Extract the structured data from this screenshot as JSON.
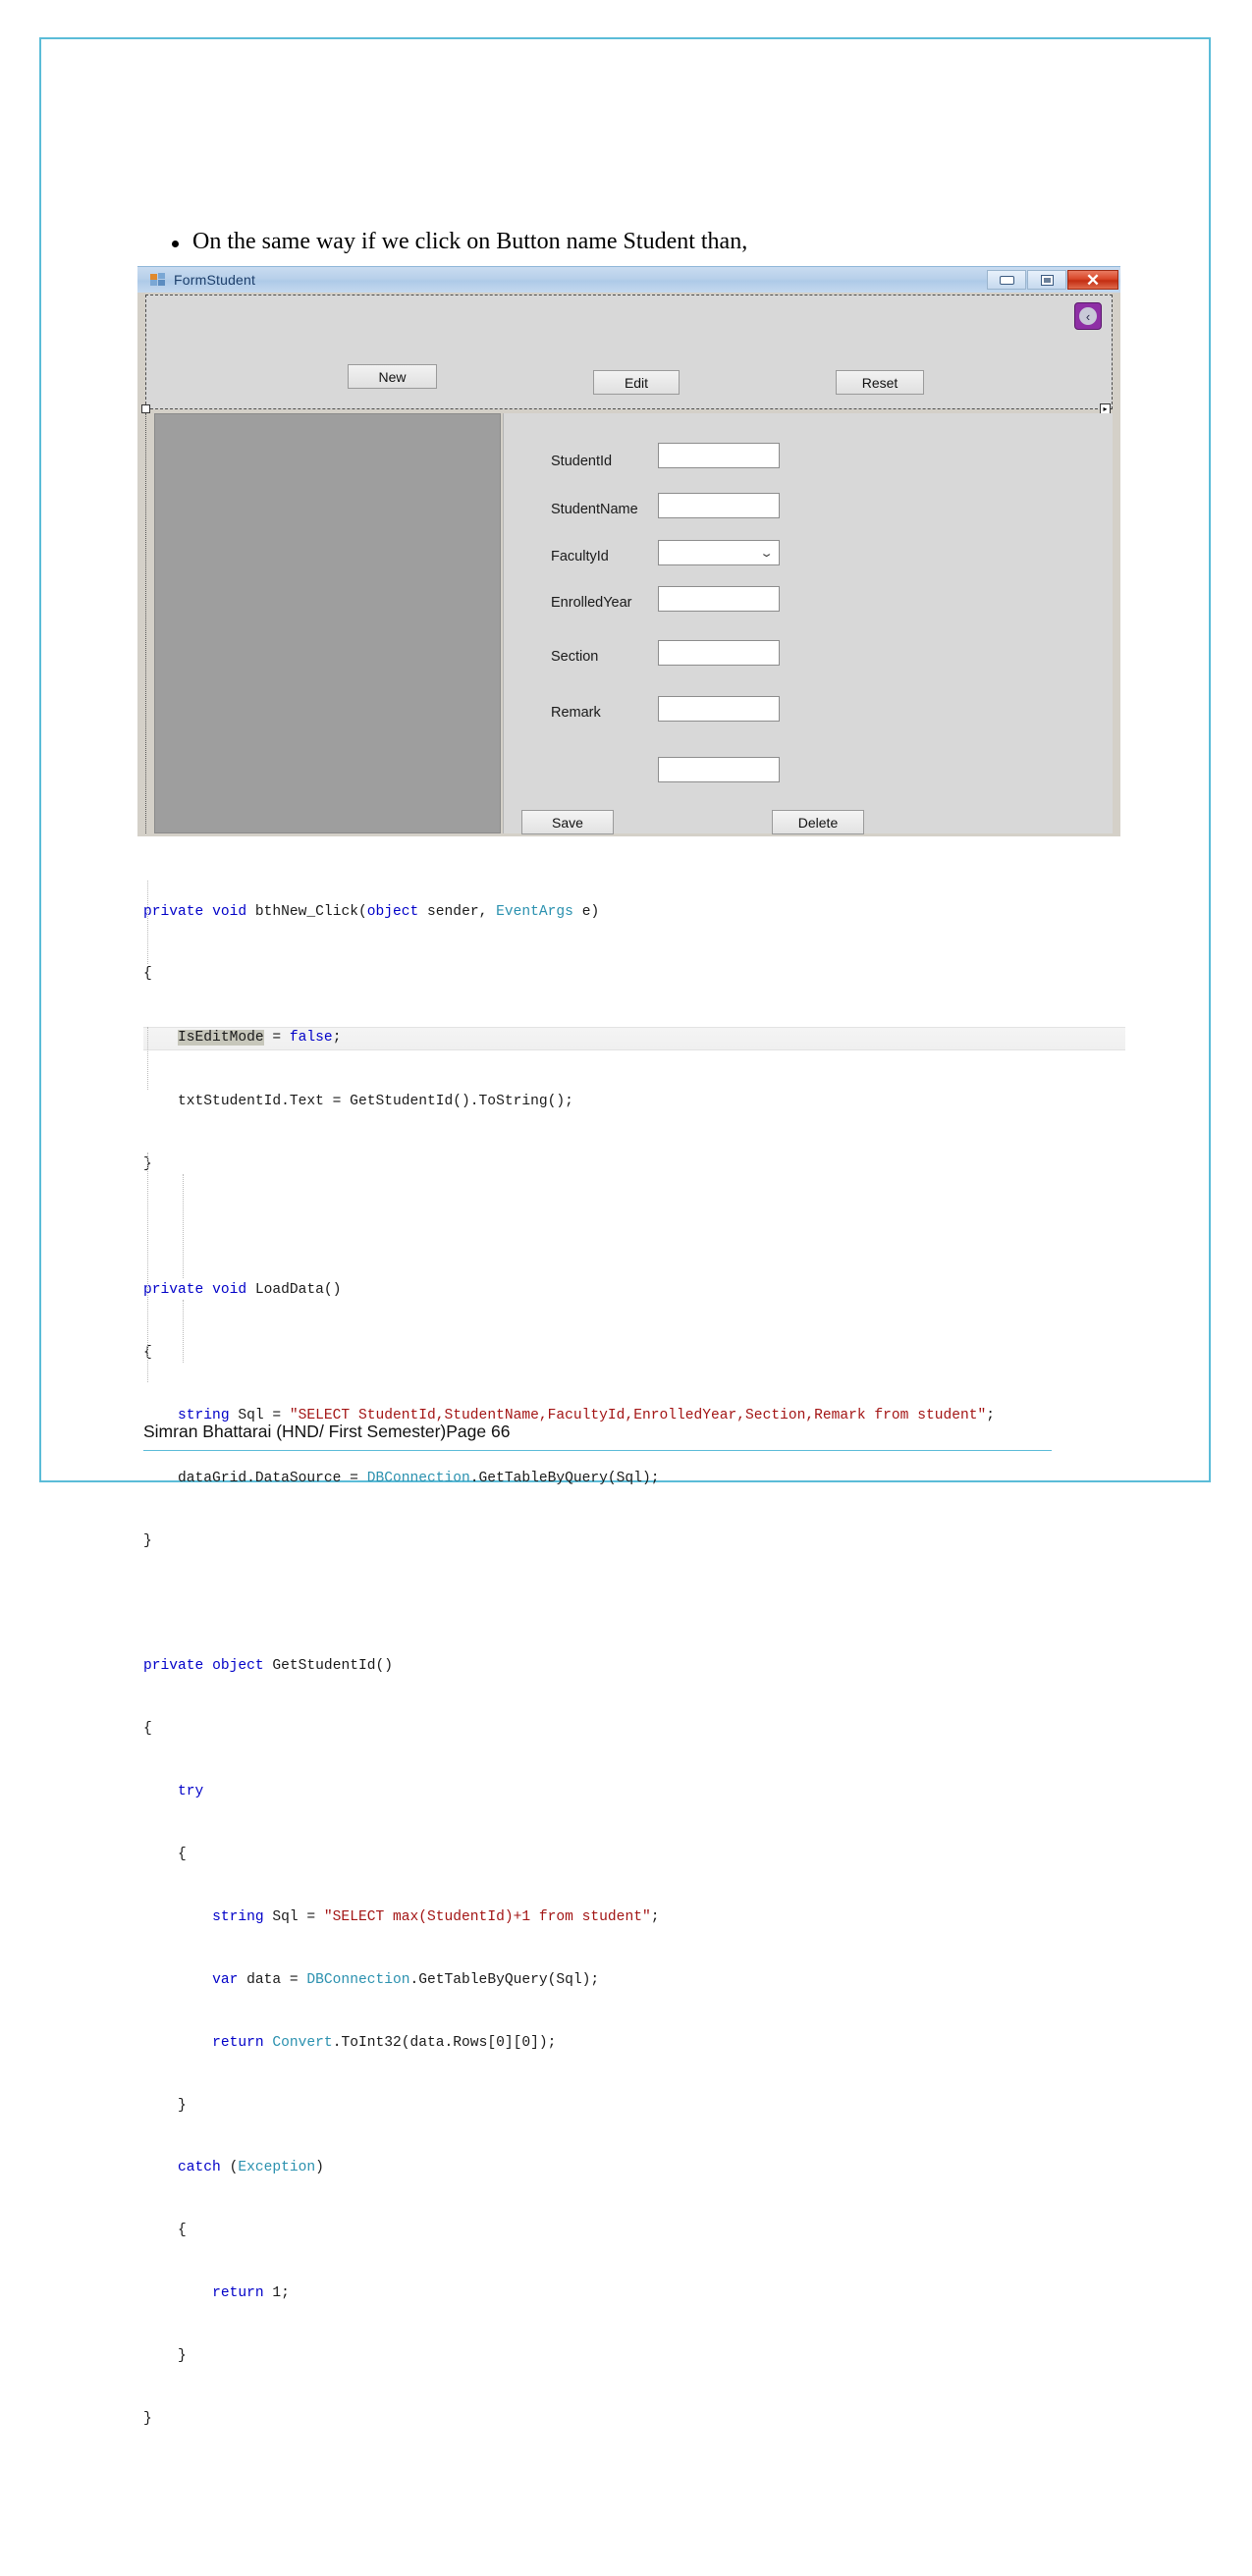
{
  "document": {
    "bullet_text": "On the same way if we click on Button name Student than,",
    "footer_text": "Simran Bhattarai (HND/ First Semester)Page 66",
    "accent_color": "#5bbcd8"
  },
  "winform": {
    "title": "FormStudent",
    "titlebar_icon": "form-icon",
    "window_controls": {
      "minimize": "–",
      "maximize": "□",
      "close": "✕"
    },
    "toolbar": {
      "back_button": "‹",
      "buttons": [
        {
          "label": "New",
          "name": "new-button"
        },
        {
          "label": "Edit",
          "name": "edit-button"
        },
        {
          "label": "Reset",
          "name": "reset-button"
        }
      ]
    },
    "fields": [
      {
        "label": "StudentId",
        "value": "",
        "type": "text"
      },
      {
        "label": "StudentName",
        "value": "",
        "type": "text"
      },
      {
        "label": "FacultyId",
        "value": "",
        "type": "combo"
      },
      {
        "label": "EnrolledYear",
        "value": "",
        "type": "text"
      },
      {
        "label": "Section",
        "value": "",
        "type": "text"
      },
      {
        "label": "Remark",
        "value": "",
        "type": "text"
      },
      {
        "label": "",
        "value": "",
        "type": "text"
      }
    ],
    "combo_chevron": "⌄",
    "action_buttons": [
      {
        "label": "Save",
        "name": "save-button"
      },
      {
        "label": "Delete",
        "name": "delete-button"
      }
    ]
  },
  "code": {
    "lines": [
      {
        "id": 1,
        "text": "private void bthNew_Click(object sender, EventArgs e)"
      },
      {
        "id": 2,
        "text": "{"
      },
      {
        "id": 3,
        "text": "    IsEditMode = false;"
      },
      {
        "id": 4,
        "text": "    txtStudentId.Text = GetStudentId().ToString();"
      },
      {
        "id": 5,
        "text": "}"
      },
      {
        "id": 6,
        "text": ""
      },
      {
        "id": 7,
        "text": "private void LoadData()"
      },
      {
        "id": 8,
        "text": "{"
      },
      {
        "id": 9,
        "text": "    string Sql = \"SELECT StudentId,StudentName,FacultyId,EnrolledYear,Section,Remark from student\";"
      },
      {
        "id": 10,
        "text": "    dataGrid.DataSource = DBConnection.GetTableByQuery(Sql);"
      },
      {
        "id": 11,
        "text": "}"
      },
      {
        "id": 12,
        "text": ""
      },
      {
        "id": 13,
        "text": "private object GetStudentId()"
      },
      {
        "id": 14,
        "text": "{"
      },
      {
        "id": 15,
        "text": "    try"
      },
      {
        "id": 16,
        "text": "    {"
      },
      {
        "id": 17,
        "text": "        string Sql = \"SELECT max(StudentId)+1 from student\";"
      },
      {
        "id": 18,
        "text": "        var data = DBConnection.GetTableByQuery(Sql);"
      },
      {
        "id": 19,
        "text": "        return Convert.ToInt32(data.Rows[0][0]);"
      },
      {
        "id": 20,
        "text": "    }"
      },
      {
        "id": 21,
        "text": "    catch (Exception)"
      },
      {
        "id": 22,
        "text": "    {"
      },
      {
        "id": 23,
        "text": "        return 1;"
      },
      {
        "id": 24,
        "text": "    }"
      },
      {
        "id": 25,
        "text": "}"
      }
    ]
  }
}
